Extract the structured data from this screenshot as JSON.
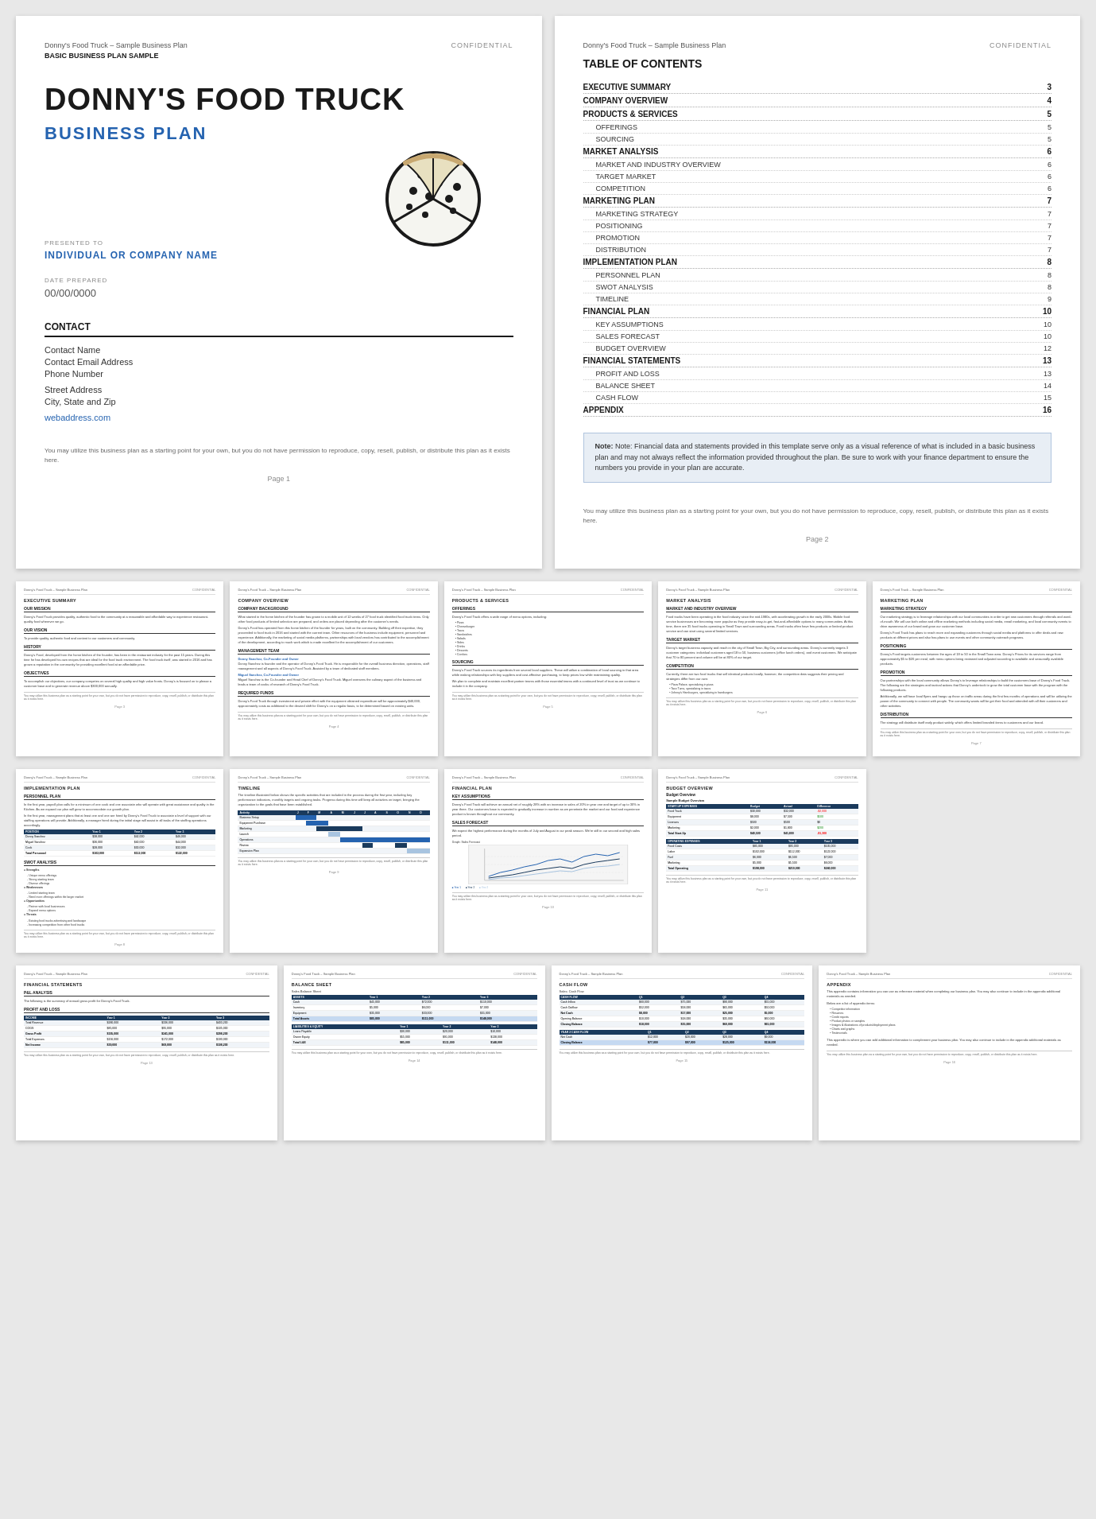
{
  "app": {
    "title": "Donny's Food Truck - Sample Business Plan"
  },
  "cover": {
    "header_left": "Donny's Food Truck – Sample Business Plan",
    "header_right": "CONFIDENTIAL",
    "plan_type": "BASIC BUSINESS PLAN SAMPLE",
    "business_name": "DONNY'S FOOD TRUCK",
    "plan_label": "BUSINESS PLAN",
    "presented_label": "PRESENTED TO",
    "presented_value": "INDIVIDUAL OR COMPANY NAME",
    "date_label": "DATE PREPARED",
    "date_value": "00/00/0000",
    "contact_header": "CONTACT",
    "contact_name": "Contact Name",
    "contact_email": "Contact Email Address",
    "contact_phone": "Phone Number",
    "contact_address1": "Street Address",
    "contact_address2": "City, State and Zip",
    "contact_web": "webaddress.com",
    "footer_note": "You may utilize this business plan as a starting point for your own, but you do not have permission to reproduce, copy, resell, publish, or distribute this plan as it exists here.",
    "page_number": "Page 1"
  },
  "toc": {
    "header_left": "Donny's Food Truck – Sample Business Plan",
    "header_right": "CONFIDENTIAL",
    "title": "TABLE OF CONTENTS",
    "items": [
      {
        "label": "EXECUTIVE SUMMARY",
        "page": "3"
      },
      {
        "label": "COMPANY OVERVIEW",
        "page": "4"
      },
      {
        "label": "PRODUCTS & SERVICES",
        "page": "5",
        "children": [
          {
            "label": "OFFERINGS",
            "page": "5"
          },
          {
            "label": "SOURCING",
            "page": "5"
          }
        ]
      },
      {
        "label": "MARKET ANALYSIS",
        "page": "6",
        "children": [
          {
            "label": "MARKET AND INDUSTRY OVERVIEW",
            "page": "6"
          },
          {
            "label": "TARGET MARKET",
            "page": "6"
          },
          {
            "label": "COMPETITION",
            "page": "6"
          }
        ]
      },
      {
        "label": "MARKETING PLAN",
        "page": "7",
        "children": [
          {
            "label": "MARKETING STRATEGY",
            "page": "7"
          },
          {
            "label": "POSITIONING",
            "page": "7"
          },
          {
            "label": "PROMOTION",
            "page": "7"
          },
          {
            "label": "DISTRIBUTION",
            "page": "7"
          }
        ]
      },
      {
        "label": "IMPLEMENTATION PLAN",
        "page": "8",
        "children": [
          {
            "label": "PERSONNEL PLAN",
            "page": "8"
          },
          {
            "label": "SWOT ANALYSIS",
            "page": "8"
          },
          {
            "label": "TIMELINE",
            "page": "9"
          }
        ]
      },
      {
        "label": "FINANCIAL PLAN",
        "page": "10",
        "children": [
          {
            "label": "KEY ASSUMPTIONS",
            "page": "10"
          },
          {
            "label": "SALES FORECAST",
            "page": "10"
          },
          {
            "label": "BUDGET OVERVIEW",
            "page": "12"
          }
        ]
      },
      {
        "label": "FINANCIAL STATEMENTS",
        "page": "13",
        "children": [
          {
            "label": "PROFIT AND LOSS",
            "page": "13"
          },
          {
            "label": "BALANCE SHEET",
            "page": "14"
          },
          {
            "label": "CASH FLOW",
            "page": "15"
          }
        ]
      },
      {
        "label": "APPENDIX",
        "page": "16"
      }
    ],
    "note": "Note: Financial data and statements provided in this template serve only as a visual reference of what is included in a basic business plan and may not always reflect the information provided throughout the plan. Be sure to work with your finance department to ensure the numbers you provide in your plan are accurate.",
    "footer_note": "You may utilize this business plan as a starting point for your own, but you do not have permission to reproduce, copy, resell, publish, or distribute this plan as it exists here.",
    "page_number": "Page 2"
  },
  "small_pages": {
    "p3": {
      "title": "EXECUTIVE SUMMARY",
      "section1": "Our Mission",
      "section2": "Our Vision",
      "section3": "History",
      "section4": "Objectives",
      "page_num": "Page 3"
    },
    "p4": {
      "title": "COMPANY OVERVIEW",
      "section1": "Company Background",
      "section2": "Management Team",
      "section3": "Required Funds",
      "page_num": "Page 4"
    },
    "p5": {
      "title": "PRODUCTS & SERVICES",
      "section1": "Offerings",
      "section2": "Sourcing",
      "page_num": "Page 5"
    },
    "p6": {
      "title": "MARKET ANALYSIS",
      "section1": "Market and Industry Overview",
      "section2": "Target Market",
      "section3": "Competition",
      "page_num": "Page 6"
    },
    "p7": {
      "title": "MARKETING PLAN",
      "section1": "Marketing Strategy",
      "section2": "Positioning",
      "section3": "Promotion",
      "section4": "Distribution",
      "page_num": "Page 7"
    },
    "p8": {
      "title": "IMPLEMENTATION PLAN",
      "section1": "Personnel Plan",
      "section2": "SWOT Analysis",
      "page_num": "Page 8"
    },
    "p9": {
      "title": "TIMELINE",
      "page_num": "Page 9"
    },
    "p10": {
      "title": "FINANCIAL PLAN",
      "section1": "Key Assumptions",
      "section2": "Sales Forecast",
      "page_num": "Page 10"
    },
    "p11": {
      "title": "BUDGET OVERVIEW",
      "page_num": "Page 11"
    },
    "p12": {
      "title": "FINANCIAL STATEMENTS",
      "section1": "P&L Analysis",
      "section2": "Profit and Loss",
      "page_num": "Page 13"
    },
    "p13": {
      "title": "BALANCE SHEET",
      "page_num": "Page 14"
    },
    "p14": {
      "title": "CASH FLOW",
      "page_num": "Page 15"
    },
    "p15": {
      "title": "APPENDIX",
      "page_num": "Page 16"
    }
  },
  "colors": {
    "blue_dark": "#1a3a5c",
    "blue_mid": "#2563b0",
    "blue_light": "#c5d9f1",
    "blue_bg": "#e8eef5",
    "gray_border": "#ddd",
    "text_dark": "#1a1a1a",
    "text_mid": "#333",
    "text_light": "#666",
    "confidential": "#888"
  }
}
